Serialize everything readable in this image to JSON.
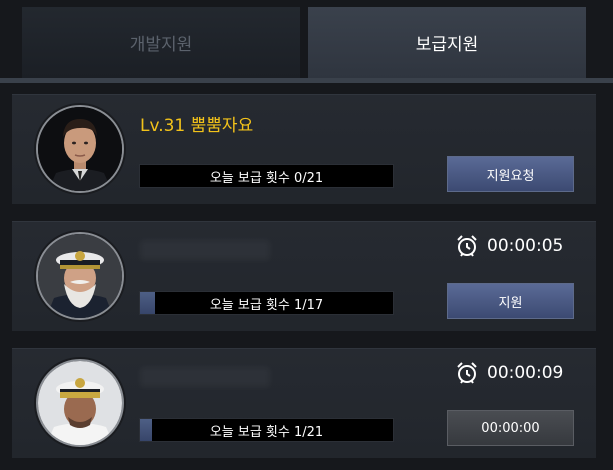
{
  "tabs": [
    {
      "label": "개발지원",
      "active": false
    },
    {
      "label": "보급지원",
      "active": true
    }
  ],
  "entries": [
    {
      "name": "Lv.31 뿜뿜자요",
      "supply_text": "오늘 보급 횟수 0/21",
      "progress": 0,
      "button_label": "지원요청",
      "timer": ""
    },
    {
      "name": "",
      "supply_text": "오늘 보급 횟수 1/17",
      "progress": 0.0588,
      "button_label": "지원",
      "timer": "00:00:05"
    },
    {
      "name": "",
      "supply_text": "오늘 보급 횟수 1/21",
      "progress": 0.0476,
      "button_label": "00:00:00",
      "timer": "00:00:09"
    }
  ],
  "icons": {
    "alarm": "alarm-clock-icon"
  },
  "colors": {
    "name_gold": "#f2c21a",
    "button_blue": "#4a5a86",
    "progress_fill": "#4e5f85"
  }
}
